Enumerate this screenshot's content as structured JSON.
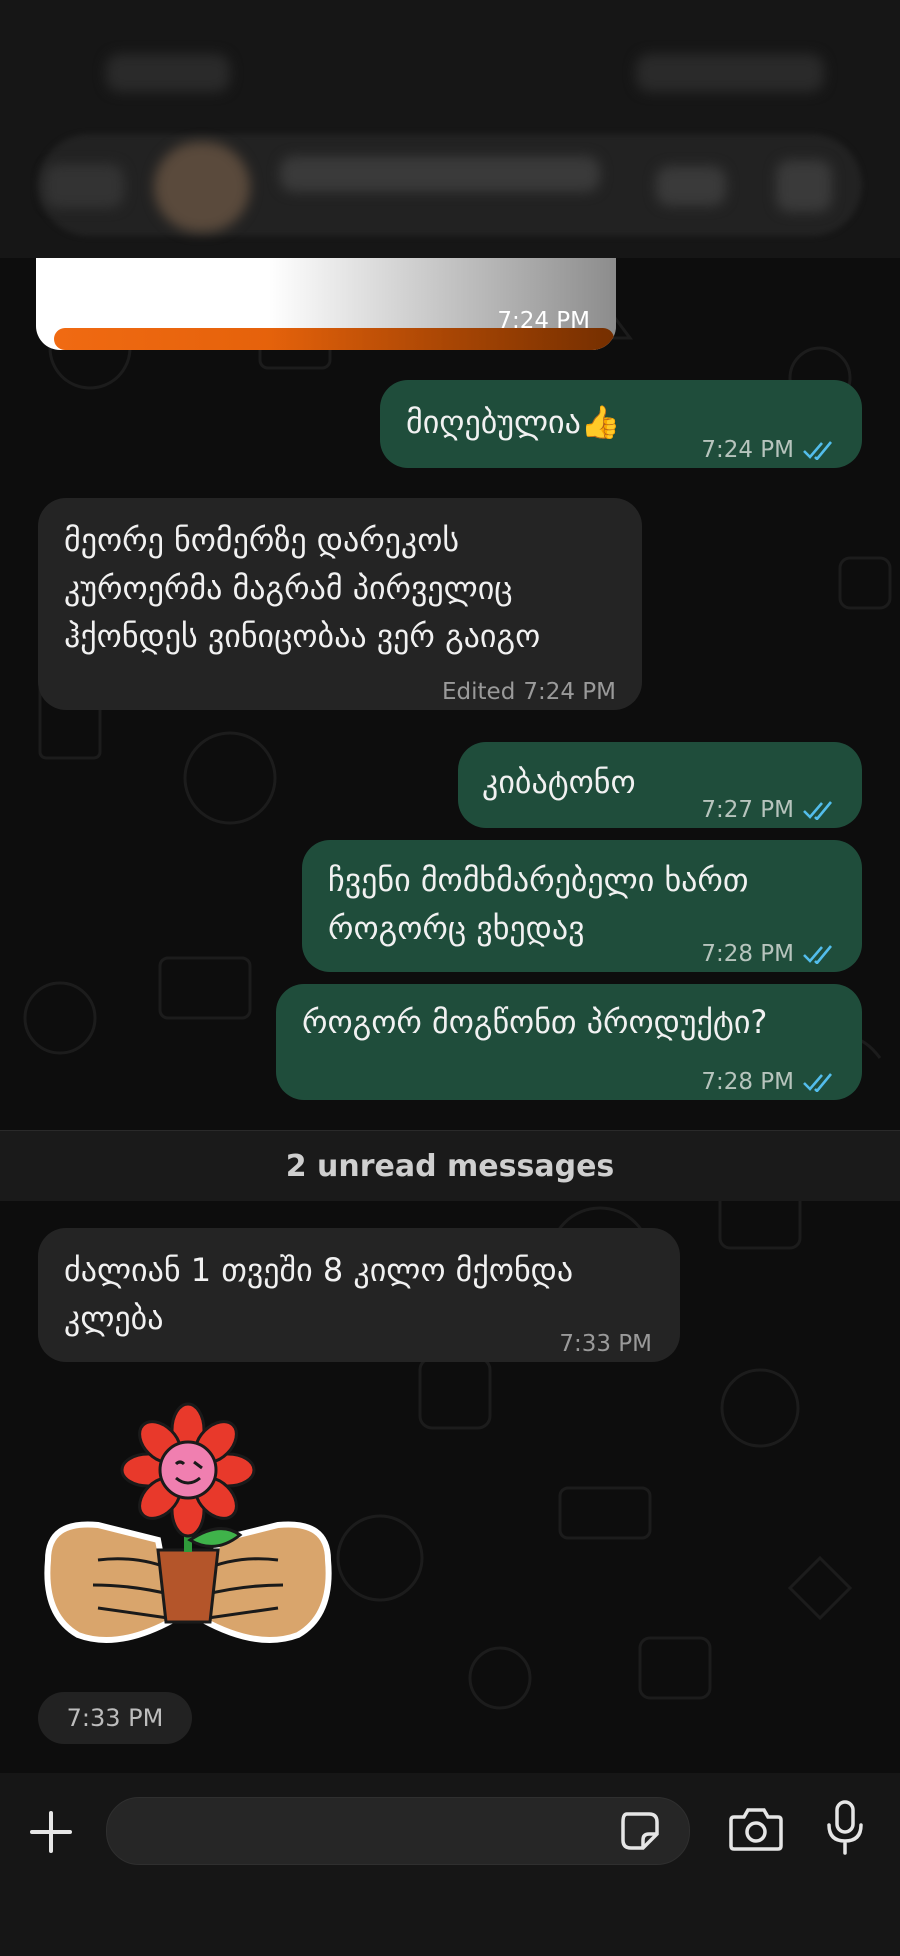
{
  "header": {
    "status_time": "",
    "contact_name": ""
  },
  "messages": [
    {
      "id": "m0",
      "direction": "incoming",
      "kind": "image-card",
      "time": "7:24 PM"
    },
    {
      "id": "m1",
      "direction": "outgoing",
      "text": "მიღებულია👍",
      "time": "7:24 PM",
      "status": "read"
    },
    {
      "id": "m2",
      "direction": "incoming",
      "lines": [
        "მეორე ნომერზე დარეკოს",
        "კუროერმა მაგრამ პირველიც",
        "ჰქონდეს ვინიცობაა ვერ გაიგო"
      ],
      "edited_label": "Edited",
      "time": "7:24 PM"
    },
    {
      "id": "m3",
      "direction": "outgoing",
      "text": "კიბატონო",
      "time": "7:27 PM",
      "status": "read"
    },
    {
      "id": "m4",
      "direction": "outgoing",
      "lines": [
        "ჩვენი მომხმარებელი ხართ",
        "როგორც ვხედავ"
      ],
      "time": "7:28 PM",
      "status": "read"
    },
    {
      "id": "m5",
      "direction": "outgoing",
      "text": "როგორ მოგწონთ პროდუქტი?",
      "time": "7:28 PM",
      "status": "read"
    },
    {
      "id": "m6",
      "direction": "incoming",
      "lines": [
        "ძალიან 1 თვეში 8 კილო მქონდა",
        "კლება"
      ],
      "time": "7:33 PM"
    },
    {
      "id": "m7",
      "direction": "incoming",
      "kind": "sticker",
      "sticker": "flower-in-hands",
      "time": "7:33 PM"
    }
  ],
  "unread_banner": "2 unread messages",
  "composer": {
    "placeholder": "",
    "icons": [
      "plus-icon",
      "sticker-icon",
      "camera-icon",
      "microphone-icon"
    ]
  },
  "colors": {
    "outgoing_bubble": "#1f4d3b",
    "incoming_bubble": "#242424",
    "read_tick": "#53bdeb",
    "card_accent": "#f06a12"
  }
}
